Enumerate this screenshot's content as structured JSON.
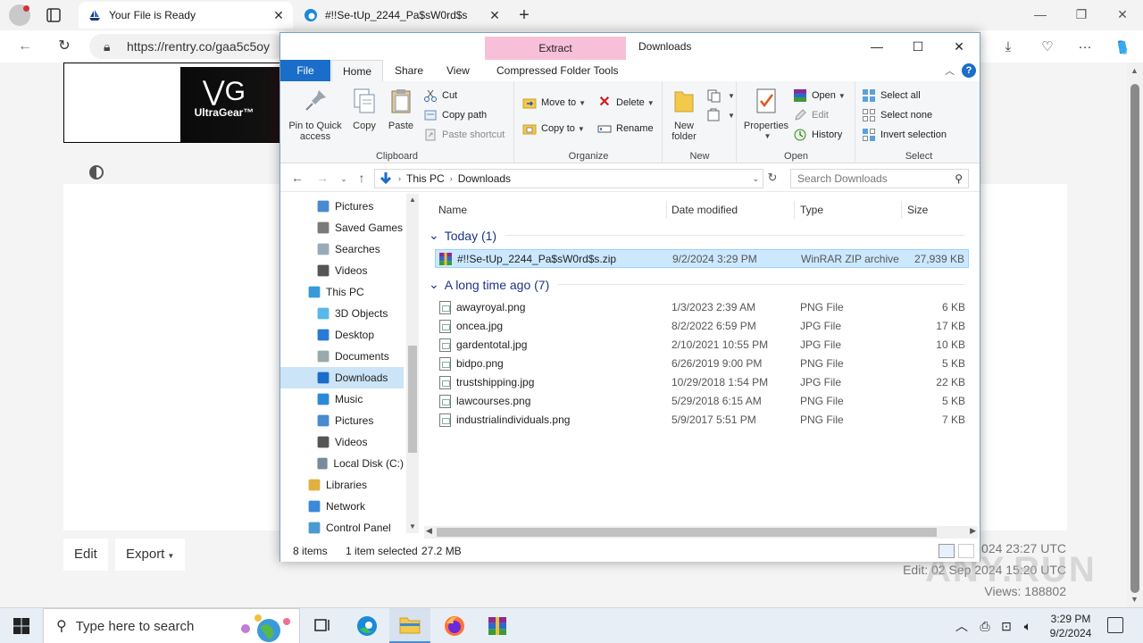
{
  "browser": {
    "tabs": [
      {
        "title": "Your File is Ready",
        "active": true
      },
      {
        "title": "#!!Se-tUp_2244_Pa$sW0rd$s",
        "active": false
      }
    ],
    "url": "https://rentry.co/gaa5c5oy"
  },
  "webpage": {
    "banner": {
      "brand": "UltraGear™"
    },
    "buttons": {
      "edit": "Edit",
      "export": "Export"
    },
    "meta": {
      "published_partial": "024 23:27 UTC",
      "edit": "Edit: 02 Sep 2024 15:20 UTC",
      "views": "Views: 188802"
    },
    "watermark": "ANY.RUN"
  },
  "explorer": {
    "title": "Downloads",
    "context_tab": "Extract",
    "ribbon_tabs": [
      "File",
      "Home",
      "Share",
      "View",
      "Compressed Folder Tools"
    ],
    "groups": {
      "clipboard": {
        "label": "Clipboard",
        "pin": "Pin to Quick access",
        "copy": "Copy",
        "paste": "Paste",
        "cut": "Cut",
        "copy_path": "Copy path",
        "paste_shortcut": "Paste shortcut"
      },
      "organize": {
        "label": "Organize",
        "move_to": "Move to",
        "copy_to": "Copy to",
        "delete": "Delete",
        "rename": "Rename"
      },
      "new": {
        "label": "New",
        "new_folder": "New folder"
      },
      "open": {
        "label": "Open",
        "properties": "Properties",
        "open": "Open",
        "edit": "Edit",
        "history": "History"
      },
      "select": {
        "label": "Select",
        "select_all": "Select all",
        "select_none": "Select none",
        "invert": "Invert selection"
      }
    },
    "path": [
      "This PC",
      "Downloads"
    ],
    "search_placeholder": "Search Downloads",
    "nav_items": [
      {
        "label": "Pictures",
        "icon": "pictures-icon",
        "indent": 1
      },
      {
        "label": "Saved Games",
        "icon": "saved-games-icon",
        "indent": 1
      },
      {
        "label": "Searches",
        "icon": "searches-icon",
        "indent": 1
      },
      {
        "label": "Videos",
        "icon": "videos-icon",
        "indent": 1
      },
      {
        "label": "This PC",
        "icon": "this-pc-icon",
        "indent": 0
      },
      {
        "label": "3D Objects",
        "icon": "3d-objects-icon",
        "indent": 1
      },
      {
        "label": "Desktop",
        "icon": "desktop-icon",
        "indent": 1
      },
      {
        "label": "Documents",
        "icon": "documents-icon",
        "indent": 1
      },
      {
        "label": "Downloads",
        "icon": "downloads-icon",
        "indent": 1,
        "selected": true
      },
      {
        "label": "Music",
        "icon": "music-icon",
        "indent": 1
      },
      {
        "label": "Pictures",
        "icon": "pictures-icon",
        "indent": 1
      },
      {
        "label": "Videos",
        "icon": "videos-icon",
        "indent": 1
      },
      {
        "label": "Local Disk (C:)",
        "icon": "local-disk-icon",
        "indent": 1
      },
      {
        "label": "Libraries",
        "icon": "libraries-icon",
        "indent": 0
      },
      {
        "label": "Network",
        "icon": "network-icon",
        "indent": 0
      },
      {
        "label": "Control Panel",
        "icon": "control-panel-icon",
        "indent": 0
      }
    ],
    "columns": {
      "name": "Name",
      "date": "Date modified",
      "type": "Type",
      "size": "Size"
    },
    "groups_list": [
      {
        "title": "Today (1)",
        "files": [
          {
            "name": "#!!Se-tUp_2244_Pa$sW0rd$s.zip",
            "date": "9/2/2024 3:29 PM",
            "type": "WinRAR ZIP archive",
            "size": "27,939 KB",
            "selected": true,
            "zip": true
          }
        ]
      },
      {
        "title": "A long time ago (7)",
        "files": [
          {
            "name": "awayroyal.png",
            "date": "1/3/2023 2:39 AM",
            "type": "PNG File",
            "size": "6 KB"
          },
          {
            "name": "oncea.jpg",
            "date": "8/2/2022 6:59 PM",
            "type": "JPG File",
            "size": "17 KB"
          },
          {
            "name": "gardentotal.jpg",
            "date": "2/10/2021 10:55 PM",
            "type": "JPG File",
            "size": "10 KB"
          },
          {
            "name": "bidpo.png",
            "date": "6/26/2019 9:00 PM",
            "type": "PNG File",
            "size": "5 KB"
          },
          {
            "name": "trustshipping.jpg",
            "date": "10/29/2018 1:54 PM",
            "type": "JPG File",
            "size": "22 KB"
          },
          {
            "name": "lawcourses.png",
            "date": "5/29/2018 6:15 AM",
            "type": "PNG File",
            "size": "5 KB"
          },
          {
            "name": "industrialindividuals.png",
            "date": "5/9/2017 5:51 PM",
            "type": "PNG File",
            "size": "7 KB"
          }
        ]
      }
    ],
    "status": {
      "items": "8 items",
      "selected": "1 item selected",
      "size": "27.2 MB"
    }
  },
  "taskbar": {
    "search_placeholder": "Type here to search",
    "time": "3:29 PM",
    "date": "9/2/2024"
  },
  "colors": {
    "accent": "#1a6dc9",
    "selection": "#cce8ff",
    "context_tab": "#f8c0d8"
  }
}
